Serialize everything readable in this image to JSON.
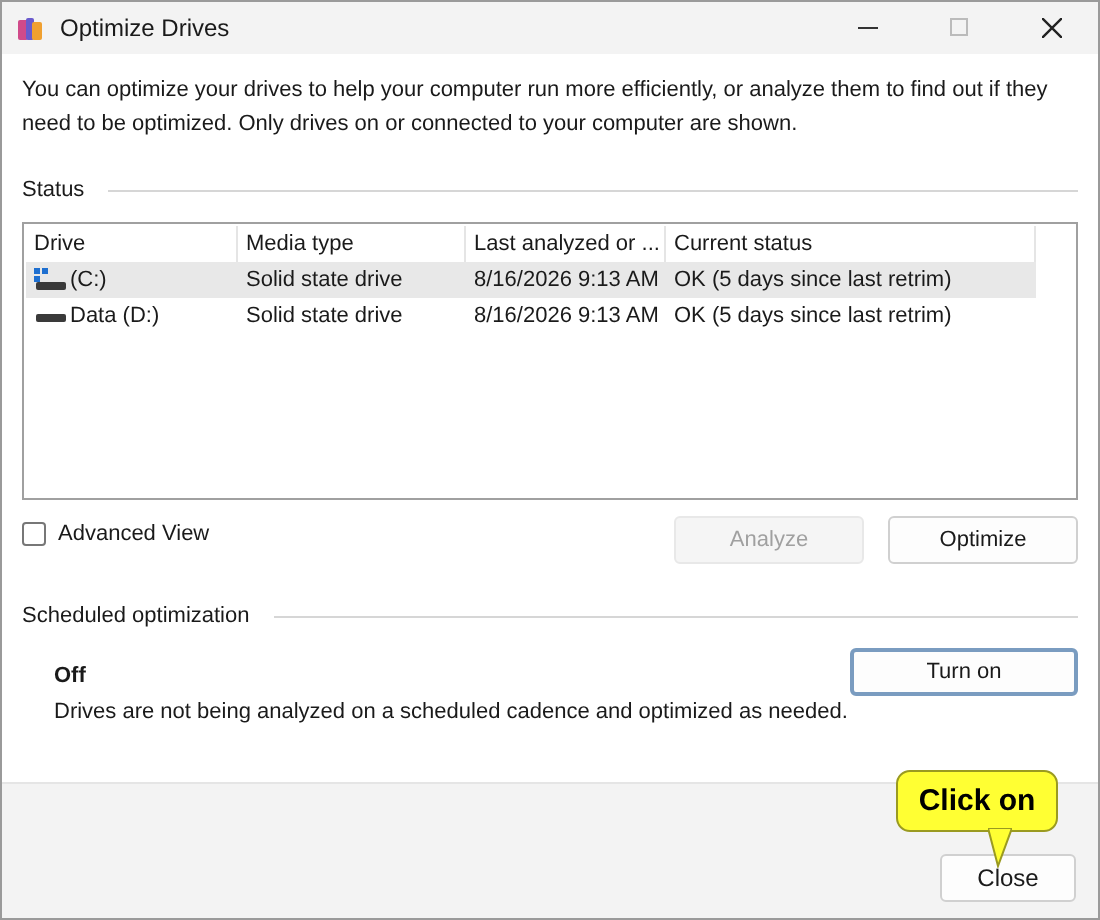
{
  "window": {
    "title": "Optimize Drives"
  },
  "description": "You can optimize your drives to help your computer run more efficiently, or analyze them to find out if they need to be optimized. Only drives on or connected to your computer are shown.",
  "status": {
    "label": "Status"
  },
  "table": {
    "columns": [
      "Drive",
      "Media type",
      "Last analyzed or ...",
      "Current status"
    ],
    "rows": [
      {
        "kind": "system",
        "cells": [
          "(C:)",
          "Solid state drive",
          "8/16/2026 9:13 AM",
          "OK (5 days since last retrim)"
        ],
        "selected": true
      },
      {
        "kind": "data",
        "cells": [
          "Data (D:)",
          "Solid state drive",
          "8/16/2026 9:13 AM",
          "OK (5 days since last retrim)"
        ],
        "selected": false
      }
    ]
  },
  "advanced_view": {
    "label": "Advanced View",
    "checked": false
  },
  "buttons": [
    {
      "label": "Analyze",
      "disabled": true
    },
    {
      "label": "Optimize",
      "disabled": false
    }
  ],
  "scheduled": {
    "label": "Scheduled optimization",
    "state": "Off",
    "description": "Drives are not being analyzed on a scheduled cadence and optimized as needed.",
    "button": "Turn on"
  },
  "footer": {
    "button": "Close"
  },
  "callout": {
    "text": "Click on"
  }
}
